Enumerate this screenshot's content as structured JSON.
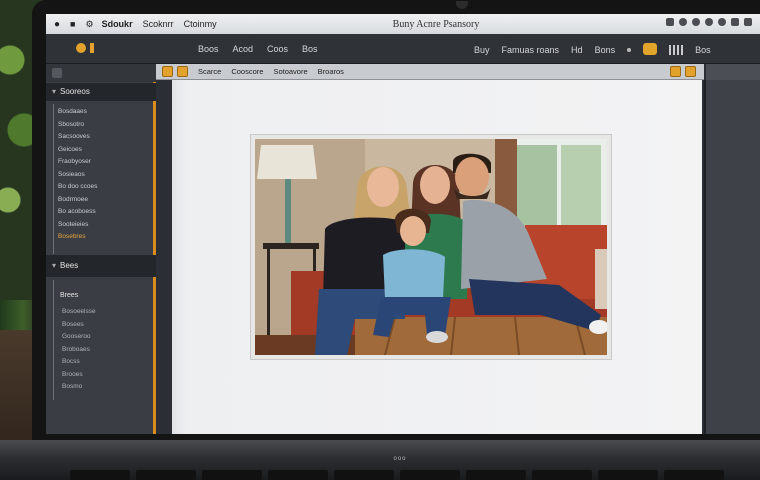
{
  "menubar": {
    "app_name": "Sdoukr",
    "menus": [
      "Scoknrr",
      "Ctoinmy"
    ],
    "window_title": "Buny Acnre Psansory"
  },
  "toolbar": {
    "logo_text": "",
    "nav": [
      "Boos",
      "Acod",
      "Coos",
      "Bos"
    ],
    "right_items": [
      "Buy",
      "Famuas roans",
      "Hd",
      "Bons"
    ],
    "far_right": "Bos"
  },
  "sidebar": {
    "header_top": "Sooreos",
    "group1": [
      "Bosdaaes",
      "Sbosotro",
      "Sacsooves",
      "Geicoes",
      "Fraobyoser",
      "Sosieaos",
      "Bo doo ccoes",
      "Bodrmoee",
      "Bo acoboess",
      "Sooteieies",
      "Bosebres"
    ],
    "group1_active_index": 10,
    "header_bottom": "Bees",
    "group2_head": "Brees",
    "group2": [
      "Bosoeelsse",
      "Bosees",
      "Gooseroo",
      "Broboaes",
      "Bocss",
      "Brooes",
      "Bosmo"
    ]
  },
  "doc": {
    "tabs": [
      "Scarce",
      "Cooscore",
      "Sotoavore",
      "Broaros"
    ]
  },
  "colors": {
    "accent": "#e3a22b",
    "sidebar_bg": "#3a3e44",
    "menubar_bg": "#e6e8ea"
  },
  "laptop": {
    "brand": "ooo"
  }
}
